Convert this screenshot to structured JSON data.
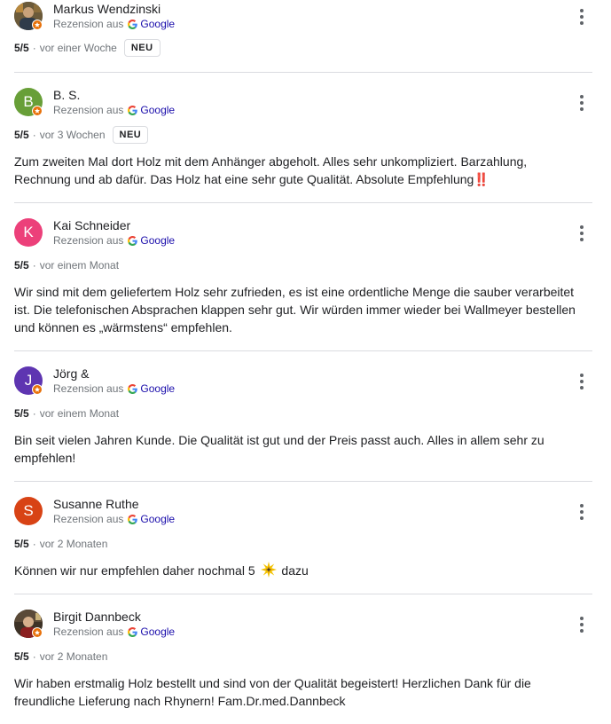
{
  "reviews": [
    {
      "name": "Markus Wendzinski",
      "initial": "",
      "avatar_color": "#5d4b2e",
      "avatar_type": "photo",
      "source_prefix": "Rezension aus",
      "source_name": "Google",
      "score": "5/5",
      "separator": "·",
      "time": "vor einer Woche",
      "badge": "NEU",
      "text": ""
    },
    {
      "name": "B. S.",
      "initial": "B",
      "avatar_color": "#689f38",
      "avatar_type": "letter",
      "source_prefix": "Rezension aus",
      "source_name": "Google",
      "score": "5/5",
      "separator": "·",
      "time": "vor 3 Wochen",
      "badge": "NEU",
      "text": "Zum zweiten Mal dort Holz mit dem Anhänger abgeholt. Alles sehr unkompliziert. Barzahlung, Rechnung und ab dafür. Das Holz hat eine sehr gute Qualität. Absolute Empfehlung‼️"
    },
    {
      "name": "Kai Schneider",
      "initial": "K",
      "avatar_color": "#ec407a",
      "avatar_type": "letter",
      "source_prefix": "Rezension aus",
      "source_name": "Google",
      "score": "5/5",
      "separator": "·",
      "time": "vor einem Monat",
      "badge": "",
      "text": "Wir sind mit dem geliefertem Holz sehr zufrieden, es ist eine ordentliche Menge die sauber verarbeitet ist. Die telefonischen Absprachen klappen sehr gut. Wir würden immer wieder bei Wallmeyer bestellen und können es „wärmstens“ empfehlen."
    },
    {
      "name": "Jörg &",
      "initial": "J",
      "avatar_color": "#5e35b1",
      "avatar_type": "letter",
      "source_prefix": "Rezension aus",
      "source_name": "Google",
      "score": "5/5",
      "separator": "·",
      "time": "vor einem Monat",
      "badge": "",
      "text": "Bin seit vielen Jahren Kunde. Die Qualität ist gut und der Preis passt auch. Alles in allem sehr zu empfehlen!"
    },
    {
      "name": "Susanne Ruthe",
      "initial": "S",
      "avatar_color": "#d84315",
      "avatar_type": "letter",
      "source_prefix": "Rezension aus",
      "source_name": "Google",
      "score": "5/5",
      "separator": "·",
      "time": "vor 2 Monaten",
      "badge": "",
      "text_before": "Können wir nur empfehlen daher nochmal 5",
      "text_after": "dazu"
    },
    {
      "name": "Birgit Dannbeck",
      "initial": "",
      "avatar_color": "#4e3b2a",
      "avatar_type": "photo",
      "source_prefix": "Rezension aus",
      "source_name": "Google",
      "score": "5/5",
      "separator": "·",
      "time": "vor 2 Monaten",
      "badge": "",
      "text": "Wir haben erstmalig Holz bestellt und sind von der Qualität begeistert! Herzlichen Dank für die freundliche Lieferung nach Rhynern! Fam.Dr.med.Dannbeck"
    }
  ]
}
